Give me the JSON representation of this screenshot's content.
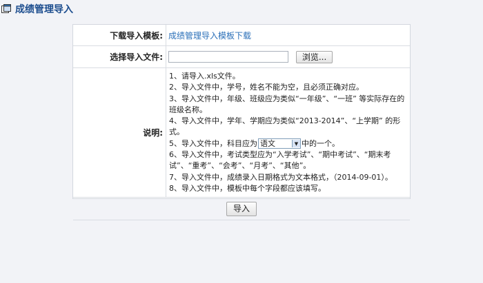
{
  "page": {
    "title": "成绩管理导入"
  },
  "form": {
    "download": {
      "label": "下载导入模板:",
      "link_text": "成绩管理导入模板下载"
    },
    "file": {
      "label": "选择导入文件:",
      "value": "",
      "browse_label": "浏览..."
    },
    "notes": {
      "label": "说明:",
      "lines": [
        "1、请导入.xls文件。",
        "2、导入文件中，学号，姓名不能为空，且必须正确对应。",
        "3、导入文件中，年级、班级应为类似“一年级”、“一班” 等实际存在的班级名称。",
        "4、导入文件中，学年、学期应为类似“2013-2014”、“上学期” 的形式。",
        "6、导入文件中，考试类型应为“入学考试”、“期中考试”、“期末考试”、“重考”、“会考”、“月考”、“其他”。",
        "7、导入文件中，成绩录入日期格式为文本格式，（2014-09-01）。",
        "8、导入文件中，模板中每个字段都应该填写。"
      ],
      "line5_prefix": "5、导入文件中，科目应为",
      "line5_suffix": "中的一个。",
      "subject_selected": "语文"
    },
    "submit_label": "导入"
  },
  "icons": {
    "title_icon": "window-icon"
  },
  "colors": {
    "title": "#1d4e8f",
    "link": "#2a6fb8",
    "background": "#f2f3f7"
  }
}
